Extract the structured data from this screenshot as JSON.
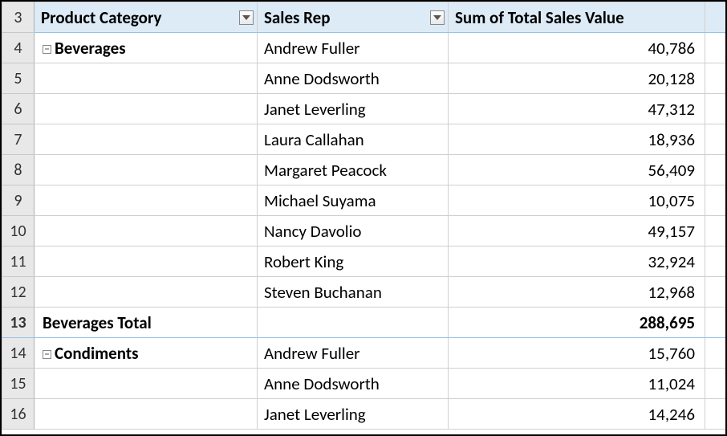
{
  "headers": {
    "product_category": "Product Category",
    "sales_rep": "Sales Rep",
    "sum_total": "Sum of Total Sales Value"
  },
  "row_numbers": [
    "3",
    "4",
    "5",
    "6",
    "7",
    "8",
    "9",
    "10",
    "11",
    "12",
    "13",
    "14",
    "15",
    "16"
  ],
  "rows": [
    {
      "type": "data",
      "category": "Beverages",
      "show_category": true,
      "rep": "Andrew Fuller",
      "value": "40,786"
    },
    {
      "type": "data",
      "category": "",
      "show_category": false,
      "rep": "Anne Dodsworth",
      "value": "20,128"
    },
    {
      "type": "data",
      "category": "",
      "show_category": false,
      "rep": "Janet Leverling",
      "value": "47,312"
    },
    {
      "type": "data",
      "category": "",
      "show_category": false,
      "rep": "Laura Callahan",
      "value": "18,936"
    },
    {
      "type": "data",
      "category": "",
      "show_category": false,
      "rep": "Margaret Peacock",
      "value": "56,409"
    },
    {
      "type": "data",
      "category": "",
      "show_category": false,
      "rep": "Michael Suyama",
      "value": "10,075"
    },
    {
      "type": "data",
      "category": "",
      "show_category": false,
      "rep": "Nancy Davolio",
      "value": "49,157"
    },
    {
      "type": "data",
      "category": "",
      "show_category": false,
      "rep": "Robert King",
      "value": "32,924"
    },
    {
      "type": "data",
      "category": "",
      "show_category": false,
      "rep": "Steven Buchanan",
      "value": "12,968"
    },
    {
      "type": "total",
      "label": "Beverages Total",
      "value": "288,695"
    },
    {
      "type": "data",
      "category": "Condiments",
      "show_category": true,
      "rep": "Andrew Fuller",
      "value": "15,760"
    },
    {
      "type": "data",
      "category": "",
      "show_category": false,
      "rep": "Anne Dodsworth",
      "value": "11,024"
    },
    {
      "type": "data",
      "category": "",
      "show_category": false,
      "rep": "Janet Leverling",
      "value": "14,246"
    }
  ]
}
